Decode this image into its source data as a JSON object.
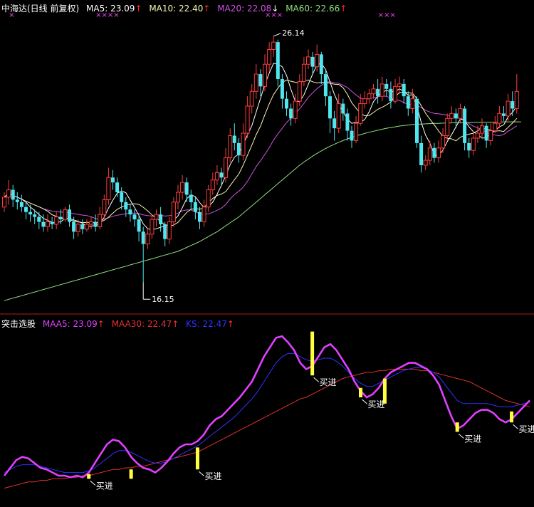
{
  "colors": {
    "background": "#000000",
    "up_candle": "#ff3b3b",
    "down_candle": "#4fe6f0",
    "ma5": "#ffffff",
    "ma10": "#f6f6b0",
    "ma20": "#d050e0",
    "ma60": "#90e080",
    "divider": "#b02020",
    "maa5": "#e040ff",
    "maa30": "#e03030",
    "ks": "#3030ff",
    "signal_bar": "#ffff40",
    "signal_text": "#ffffff",
    "marker": "#ff40ff"
  },
  "top_panel": {
    "title": "中海达(日线 前复权)",
    "legend": [
      {
        "name": "MA5",
        "label": "MA5: 23.09",
        "arrow": "↑",
        "color": "#ffffff"
      },
      {
        "name": "MA10",
        "label": "MA10: 22.40",
        "arrow": "↑",
        "color": "#f6f6b0"
      },
      {
        "name": "MA20",
        "label": "MA20: 22.08",
        "arrow": "↓",
        "color": "#d050e0"
      },
      {
        "name": "MA60",
        "label": "MA60: 22.66",
        "arrow": "↑",
        "color": "#90e080"
      }
    ],
    "annotations": {
      "high": "26.14",
      "low": "16.15"
    }
  },
  "bottom_panel": {
    "title": "突击选股",
    "legend": [
      {
        "name": "MAA5",
        "label": "MAA5: 23.09",
        "arrow": "↑",
        "color": "#e040ff"
      },
      {
        "name": "MAA30",
        "label": "MAA30: 22.47",
        "arrow": "↑",
        "color": "#e03030"
      },
      {
        "name": "KS",
        "label": "KS: 22.47",
        "arrow": "↑",
        "color": "#3030ff"
      }
    ],
    "signal_label": "买进"
  },
  "chart_data": [
    {
      "type": "candlestick",
      "ylim": [
        15.0,
        26.8
      ],
      "high_point": {
        "index": 62,
        "value": 26.14
      },
      "low_point": {
        "index": 32,
        "value": 16.15
      },
      "top_markers": [
        {
          "index": 1,
          "symbol": "×"
        },
        {
          "index": 21,
          "symbol": "××××"
        },
        {
          "index": 60,
          "symbol": "×××"
        },
        {
          "index": 86,
          "symbol": "×××"
        }
      ],
      "candles": [
        [
          19.2,
          19.6,
          19.8,
          19.0
        ],
        [
          19.6,
          19.9,
          20.3,
          19.3
        ],
        [
          19.9,
          19.5,
          20.1,
          19.2
        ],
        [
          19.5,
          19.4,
          19.8,
          19.1
        ],
        [
          19.4,
          19.2,
          19.7,
          19.0
        ],
        [
          19.2,
          19.0,
          19.4,
          18.7
        ],
        [
          19.0,
          18.9,
          19.3,
          18.6
        ],
        [
          18.9,
          18.8,
          19.1,
          18.5
        ],
        [
          18.8,
          18.6,
          19.0,
          18.3
        ],
        [
          18.6,
          18.4,
          18.9,
          18.2
        ],
        [
          18.4,
          18.6,
          18.9,
          18.2
        ],
        [
          18.6,
          18.5,
          18.8,
          18.3
        ],
        [
          18.5,
          18.8,
          19.0,
          18.3
        ],
        [
          18.8,
          18.7,
          19.1,
          18.5
        ],
        [
          18.7,
          19.1,
          19.2,
          18.6
        ],
        [
          19.1,
          18.6,
          19.3,
          18.4
        ],
        [
          18.6,
          18.2,
          18.8,
          17.9
        ],
        [
          18.2,
          18.5,
          18.7,
          18.0
        ],
        [
          18.5,
          18.3,
          18.7,
          18.1
        ],
        [
          18.3,
          18.5,
          18.7,
          18.2
        ],
        [
          18.5,
          18.6,
          18.8,
          18.3
        ],
        [
          18.6,
          18.4,
          18.9,
          18.2
        ],
        [
          18.4,
          18.9,
          19.2,
          18.3
        ],
        [
          18.9,
          19.5,
          19.7,
          18.7
        ],
        [
          19.5,
          20.4,
          20.8,
          19.3
        ],
        [
          20.4,
          20.2,
          20.7,
          19.9
        ],
        [
          20.2,
          19.8,
          20.4,
          19.6
        ],
        [
          19.8,
          19.4,
          20.0,
          19.1
        ],
        [
          19.4,
          19.1,
          19.6,
          18.8
        ],
        [
          19.1,
          18.9,
          19.3,
          18.6
        ],
        [
          18.9,
          18.7,
          19.1,
          18.4
        ],
        [
          18.7,
          18.2,
          18.9,
          17.8
        ],
        [
          18.2,
          17.7,
          18.4,
          16.15
        ],
        [
          17.7,
          18.1,
          18.3,
          17.5
        ],
        [
          18.1,
          18.7,
          18.9,
          17.9
        ],
        [
          18.7,
          18.9,
          19.1,
          18.4
        ],
        [
          18.9,
          18.5,
          19.2,
          18.2
        ],
        [
          18.5,
          17.9,
          18.6,
          17.6
        ],
        [
          17.9,
          18.6,
          18.8,
          17.7
        ],
        [
          18.6,
          19.4,
          19.6,
          18.4
        ],
        [
          19.4,
          19.8,
          20.1,
          19.1
        ],
        [
          19.8,
          20.2,
          20.5,
          19.5
        ],
        [
          20.2,
          19.7,
          20.4,
          19.4
        ],
        [
          19.7,
          19.4,
          19.9,
          19.1
        ],
        [
          19.4,
          19.0,
          19.6,
          18.7
        ],
        [
          19.0,
          18.6,
          19.2,
          18.3
        ],
        [
          18.6,
          19.2,
          19.5,
          18.4
        ],
        [
          19.2,
          19.9,
          20.1,
          19.0
        ],
        [
          19.9,
          20.3,
          20.6,
          19.7
        ],
        [
          20.3,
          20.6,
          20.9,
          20.1
        ],
        [
          20.6,
          20.4,
          20.8,
          20.1
        ],
        [
          20.4,
          21.2,
          21.6,
          20.2
        ],
        [
          21.2,
          22.1,
          22.4,
          21.0
        ],
        [
          22.1,
          21.8,
          22.6,
          21.5
        ],
        [
          21.8,
          21.3,
          22.0,
          21.0
        ],
        [
          21.3,
          22.2,
          22.6,
          21.1
        ],
        [
          22.2,
          23.3,
          23.7,
          22.0
        ],
        [
          23.3,
          23.9,
          24.2,
          23.0
        ],
        [
          23.9,
          24.6,
          25.0,
          23.6
        ],
        [
          24.6,
          24.1,
          24.8,
          23.7
        ],
        [
          24.1,
          25.0,
          25.4,
          23.9
        ],
        [
          25.0,
          25.6,
          25.9,
          24.7
        ],
        [
          25.6,
          25.9,
          26.14,
          25.3
        ],
        [
          25.9,
          24.4,
          26.0,
          24.1
        ],
        [
          24.4,
          23.6,
          24.6,
          23.2
        ],
        [
          23.6,
          23.2,
          23.9,
          22.9
        ],
        [
          23.2,
          22.8,
          23.4,
          22.5
        ],
        [
          22.8,
          23.5,
          23.8,
          22.6
        ],
        [
          23.5,
          24.3,
          24.6,
          23.3
        ],
        [
          24.3,
          25.0,
          25.3,
          24.1
        ],
        [
          25.0,
          25.3,
          25.6,
          24.8
        ],
        [
          25.3,
          24.9,
          25.5,
          24.6
        ],
        [
          24.9,
          25.4,
          25.8,
          24.7
        ],
        [
          25.4,
          24.6,
          25.5,
          24.2
        ],
        [
          24.6,
          23.7,
          24.8,
          23.3
        ],
        [
          23.7,
          22.8,
          23.9,
          22.2
        ],
        [
          22.8,
          22.4,
          23.1,
          21.9
        ],
        [
          22.4,
          23.4,
          23.8,
          22.2
        ],
        [
          23.4,
          23.0,
          23.6,
          22.7
        ],
        [
          23.0,
          22.3,
          23.2,
          21.9
        ],
        [
          22.3,
          21.9,
          22.5,
          21.6
        ],
        [
          21.9,
          22.6,
          22.9,
          21.8
        ],
        [
          22.6,
          23.4,
          23.8,
          22.5
        ],
        [
          23.4,
          23.6,
          23.9,
          23.2
        ],
        [
          23.6,
          23.8,
          24.0,
          23.4
        ],
        [
          23.8,
          24.0,
          24.2,
          23.6
        ],
        [
          24.0,
          23.7,
          24.4,
          23.4
        ],
        [
          23.7,
          24.2,
          24.5,
          23.5
        ],
        [
          24.2,
          24.0,
          24.4,
          23.7
        ],
        [
          24.0,
          23.5,
          24.3,
          23.2
        ],
        [
          23.5,
          24.1,
          24.4,
          23.4
        ],
        [
          24.1,
          24.2,
          24.5,
          23.8
        ],
        [
          24.2,
          23.7,
          24.4,
          23.4
        ],
        [
          23.7,
          23.2,
          23.9,
          22.9
        ],
        [
          23.2,
          23.6,
          24.0,
          23.0
        ],
        [
          23.6,
          21.8,
          23.7,
          21.6
        ],
        [
          21.8,
          20.9,
          22.1,
          20.6
        ],
        [
          20.9,
          21.1,
          21.3,
          20.7
        ],
        [
          21.1,
          21.6,
          21.9,
          20.9
        ],
        [
          21.6,
          21.2,
          21.8,
          21.0
        ],
        [
          21.2,
          21.6,
          21.9,
          21.0
        ],
        [
          21.6,
          22.1,
          22.4,
          21.4
        ],
        [
          22.1,
          22.8,
          23.0,
          21.9
        ],
        [
          22.8,
          23.0,
          23.3,
          22.6
        ],
        [
          23.0,
          22.8,
          23.2,
          22.4
        ],
        [
          22.8,
          23.2,
          23.4,
          22.6
        ],
        [
          23.2,
          21.8,
          23.3,
          21.5
        ],
        [
          21.8,
          21.5,
          22.0,
          21.2
        ],
        [
          21.5,
          22.0,
          22.3,
          21.3
        ],
        [
          22.0,
          22.2,
          22.5,
          21.8
        ],
        [
          22.2,
          22.5,
          22.8,
          22.0
        ],
        [
          22.5,
          21.9,
          22.6,
          21.6
        ],
        [
          21.9,
          22.3,
          22.6,
          21.7
        ],
        [
          22.3,
          22.6,
          22.9,
          22.2
        ],
        [
          22.6,
          23.0,
          23.3,
          22.4
        ],
        [
          23.0,
          22.9,
          23.3,
          22.7
        ],
        [
          22.9,
          23.5,
          23.8,
          22.7
        ],
        [
          23.5,
          23.2,
          23.9,
          22.9
        ],
        [
          23.2,
          23.9,
          24.6,
          23.0
        ]
      ],
      "ma60": [
        15.4,
        15.45,
        15.5,
        15.55,
        15.6,
        15.65,
        15.7,
        15.75,
        15.8,
        15.85,
        15.9,
        15.95,
        16.0,
        16.05,
        16.1,
        16.15,
        16.2,
        16.25,
        16.3,
        16.35,
        16.4,
        16.45,
        16.5,
        16.55,
        16.6,
        16.65,
        16.7,
        16.75,
        16.8,
        16.85,
        16.9,
        16.95,
        17.0,
        17.05,
        17.1,
        17.15,
        17.2,
        17.25,
        17.3,
        17.35,
        17.4,
        17.48,
        17.56,
        17.64,
        17.72,
        17.8,
        17.9,
        18.0,
        18.1,
        18.2,
        18.32,
        18.44,
        18.56,
        18.68,
        18.8,
        18.95,
        19.1,
        19.25,
        19.4,
        19.55,
        19.7,
        19.85,
        20.0,
        20.15,
        20.3,
        20.45,
        20.6,
        20.75,
        20.9,
        21.03,
        21.15,
        21.27,
        21.38,
        21.48,
        21.58,
        21.67,
        21.75,
        21.83,
        21.9,
        21.97,
        22.03,
        22.09,
        22.14,
        22.19,
        22.24,
        22.28,
        22.32,
        22.36,
        22.4,
        22.43,
        22.46,
        22.49,
        22.51,
        22.53,
        22.55,
        22.56,
        22.57,
        22.58,
        22.59,
        22.6,
        22.6,
        22.61,
        22.61,
        22.62,
        22.62,
        22.62,
        22.63,
        22.63,
        22.64,
        22.64,
        22.64,
        22.65,
        22.65,
        22.65,
        22.66,
        22.66,
        22.66,
        22.66,
        22.66,
        22.66
      ]
    },
    {
      "type": "line",
      "ylim": [
        0.0,
        1.0
      ],
      "series": [
        {
          "name": "MAA5",
          "values": [
            0.1,
            0.15,
            0.2,
            0.22,
            0.21,
            0.18,
            0.15,
            0.14,
            0.12,
            0.1,
            0.1,
            0.09,
            0.1,
            0.09,
            0.12,
            0.18,
            0.24,
            0.3,
            0.33,
            0.32,
            0.28,
            0.22,
            0.18,
            0.15,
            0.14,
            0.12,
            0.15,
            0.19,
            0.24,
            0.28,
            0.3,
            0.3,
            0.32,
            0.36,
            0.42,
            0.46,
            0.48,
            0.52,
            0.56,
            0.6,
            0.65,
            0.7,
            0.78,
            0.86,
            0.92,
            0.98,
            0.99,
            0.95,
            0.9,
            0.82,
            0.78,
            0.8,
            0.86,
            0.92,
            0.94,
            0.9,
            0.84,
            0.78,
            0.7,
            0.64,
            0.6,
            0.62,
            0.66,
            0.72,
            0.76,
            0.78,
            0.8,
            0.82,
            0.82,
            0.8,
            0.78,
            0.74,
            0.68,
            0.58,
            0.48,
            0.4,
            0.42,
            0.46,
            0.5,
            0.52,
            0.52,
            0.5,
            0.46,
            0.44,
            0.46,
            0.5,
            0.54,
            0.58
          ]
        },
        {
          "name": "MAA30",
          "values": [
            0.02,
            0.03,
            0.04,
            0.05,
            0.06,
            0.06,
            0.07,
            0.07,
            0.08,
            0.08,
            0.08,
            0.09,
            0.09,
            0.1,
            0.1,
            0.11,
            0.12,
            0.13,
            0.14,
            0.14,
            0.15,
            0.15,
            0.16,
            0.16,
            0.17,
            0.18,
            0.19,
            0.2,
            0.21,
            0.22,
            0.23,
            0.24,
            0.25,
            0.27,
            0.29,
            0.31,
            0.33,
            0.35,
            0.37,
            0.39,
            0.41,
            0.43,
            0.45,
            0.47,
            0.49,
            0.51,
            0.53,
            0.55,
            0.57,
            0.59,
            0.6,
            0.62,
            0.64,
            0.66,
            0.68,
            0.7,
            0.72,
            0.73,
            0.74,
            0.75,
            0.76,
            0.76,
            0.77,
            0.77,
            0.78,
            0.78,
            0.78,
            0.78,
            0.78,
            0.77,
            0.77,
            0.76,
            0.75,
            0.74,
            0.73,
            0.72,
            0.71,
            0.7,
            0.68,
            0.66,
            0.64,
            0.62,
            0.6,
            0.58,
            0.57,
            0.56,
            0.55,
            0.54
          ]
        },
        {
          "name": "KS",
          "values": [
            0.12,
            0.14,
            0.16,
            0.17,
            0.17,
            0.17,
            0.16,
            0.15,
            0.14,
            0.13,
            0.12,
            0.12,
            0.12,
            0.12,
            0.13,
            0.15,
            0.18,
            0.21,
            0.24,
            0.26,
            0.26,
            0.25,
            0.23,
            0.21,
            0.19,
            0.18,
            0.18,
            0.19,
            0.21,
            0.23,
            0.25,
            0.27,
            0.29,
            0.32,
            0.35,
            0.38,
            0.41,
            0.44,
            0.47,
            0.51,
            0.55,
            0.59,
            0.64,
            0.7,
            0.76,
            0.82,
            0.86,
            0.88,
            0.88,
            0.86,
            0.84,
            0.83,
            0.84,
            0.85,
            0.85,
            0.83,
            0.8,
            0.76,
            0.72,
            0.69,
            0.67,
            0.67,
            0.69,
            0.71,
            0.73,
            0.75,
            0.77,
            0.78,
            0.79,
            0.79,
            0.78,
            0.76,
            0.73,
            0.68,
            0.63,
            0.58,
            0.56,
            0.56,
            0.56,
            0.56,
            0.56,
            0.55,
            0.54,
            0.54,
            0.54,
            0.55,
            0.56,
            0.57
          ]
        }
      ],
      "buy_signals": [
        {
          "index": 14,
          "low": 0.08,
          "high": 0.11,
          "labeled": true
        },
        {
          "index": 21,
          "low": 0.08,
          "high": 0.14,
          "labeled": false
        },
        {
          "index": 32,
          "low": 0.14,
          "high": 0.28,
          "labeled": true
        },
        {
          "index": 51,
          "low": 0.74,
          "high": 1.02,
          "labeled": true
        },
        {
          "index": 59,
          "low": 0.6,
          "high": 0.66,
          "labeled": true
        },
        {
          "index": 63,
          "low": 0.56,
          "high": 0.72,
          "labeled": false
        },
        {
          "index": 75,
          "low": 0.38,
          "high": 0.44,
          "labeled": true
        },
        {
          "index": 84,
          "low": 0.44,
          "high": 0.51,
          "labeled": true
        }
      ]
    }
  ]
}
